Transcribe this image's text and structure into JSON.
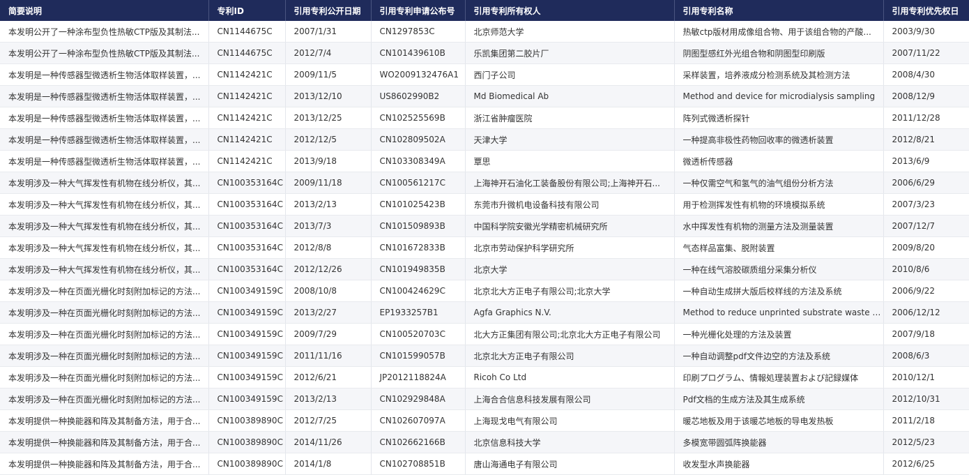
{
  "columns": [
    "简要说明",
    "专利ID",
    "引用专利公开日期",
    "引用专利申请公布号",
    "引用专利所有权人",
    "引用专利名称",
    "引用专利优先权日"
  ],
  "rows": [
    [
      "本发明公开了一种涂布型负性热敏CTP版及其制法...",
      "CN1144675C",
      "2007/1/31",
      "CN1297853C",
      "北京师范大学",
      "热敏ctp版材用成像组合物、用于该组合物的产酸...",
      "2003/9/30"
    ],
    [
      "本发明公开了一种涂布型负性热敏CTP版及其制法...",
      "CN1144675C",
      "2012/7/4",
      "CN101439610B",
      "乐凯集团第二胶片厂",
      "阴图型感红外光组合物和阴图型印刷版",
      "2007/11/22"
    ],
    [
      "本发明是一种传感器型微透析生物活体取样装置，...",
      "CN1142421C",
      "2009/11/5",
      "WO2009132476A1",
      "西门子公司",
      "采样装置，培养液成分检测系统及其检测方法",
      "2008/4/30"
    ],
    [
      "本发明是一种传感器型微透析生物活体取样装置，...",
      "CN1142421C",
      "2013/12/10",
      "US8602990B2",
      "Md Biomedical Ab",
      "Method and device for microdialysis sampling",
      "2008/12/9"
    ],
    [
      "本发明是一种传感器型微透析生物活体取样装置，...",
      "CN1142421C",
      "2013/12/25",
      "CN102525569B",
      "浙江省肿瘤医院",
      "阵列式微透析探针",
      "2011/12/28"
    ],
    [
      "本发明是一种传感器型微透析生物活体取样装置，...",
      "CN1142421C",
      "2012/12/5",
      "CN102809502A",
      "天津大学",
      "一种提高非极性药物回收率的微透析装置",
      "2012/8/21"
    ],
    [
      "本发明是一种传感器型微透析生物活体取样装置，...",
      "CN1142421C",
      "2013/9/18",
      "CN103308349A",
      "覃思",
      "微透析传感器",
      "2013/6/9"
    ],
    [
      "本发明涉及一种大气挥发性有机物在线分析仪，其...",
      "CN100353164C",
      "2009/11/18",
      "CN100561217C",
      "上海神开石油化工装备股份有限公司;上海神开石...",
      "一种仅需空气和氢气的油气组份分析方法",
      "2006/6/29"
    ],
    [
      "本发明涉及一种大气挥发性有机物在线分析仪，其...",
      "CN100353164C",
      "2013/2/13",
      "CN101025423B",
      "东莞市升微机电设备科技有限公司",
      "用于检测挥发性有机物的环境模拟系统",
      "2007/3/23"
    ],
    [
      "本发明涉及一种大气挥发性有机物在线分析仪，其...",
      "CN100353164C",
      "2013/7/3",
      "CN101509893B",
      "中国科学院安徽光学精密机械研究所",
      "水中挥发性有机物的测量方法及测量装置",
      "2007/12/7"
    ],
    [
      "本发明涉及一种大气挥发性有机物在线分析仪，其...",
      "CN100353164C",
      "2012/8/8",
      "CN101672833B",
      "北京市劳动保护科学研究所",
      "气态样品富集、脱附装置",
      "2009/8/20"
    ],
    [
      "本发明涉及一种大气挥发性有机物在线分析仪，其...",
      "CN100353164C",
      "2012/12/26",
      "CN101949835B",
      "北京大学",
      "一种在线气溶胶碳质组分采集分析仪",
      "2010/8/6"
    ],
    [
      "本发明涉及一种在页面光栅化时刻附加标记的方法...",
      "CN100349159C",
      "2008/10/8",
      "CN100424629C",
      "北京北大方正电子有限公司;北京大学",
      "一种自动生成拼大版后校样线的方法及系统",
      "2006/9/22"
    ],
    [
      "本发明涉及一种在页面光栅化时刻附加标记的方法...",
      "CN100349159C",
      "2013/2/27",
      "EP1933257B1",
      "Agfa Graphics N.V.",
      "Method to reduce unprinted substrate waste duri...",
      "2006/12/12"
    ],
    [
      "本发明涉及一种在页面光栅化时刻附加标记的方法...",
      "CN100349159C",
      "2009/7/29",
      "CN100520703C",
      "北大方正集团有限公司;北京北大方正电子有限公司",
      "一种光栅化处理的方法及装置",
      "2007/9/18"
    ],
    [
      "本发明涉及一种在页面光栅化时刻附加标记的方法...",
      "CN100349159C",
      "2011/11/16",
      "CN101599057B",
      "北京北大方正电子有限公司",
      "一种自动调整pdf文件边空的方法及系统",
      "2008/6/3"
    ],
    [
      "本发明涉及一种在页面光栅化时刻附加标记的方法...",
      "CN100349159C",
      "2012/6/21",
      "JP2012118824A",
      "Ricoh Co Ltd",
      "印刷プログラム、情報処理装置および記録媒体",
      "2010/12/1"
    ],
    [
      "本发明涉及一种在页面光栅化时刻附加标记的方法...",
      "CN100349159C",
      "2013/2/13",
      "CN102929848A",
      "上海合合信息科技发展有限公司",
      "Pdf文档的生成方法及其生成系统",
      "2012/10/31"
    ],
    [
      "本发明提供一种换能器和阵及其制备方法，用于合...",
      "CN100389890C",
      "2012/7/25",
      "CN102607097A",
      "上海现戈电气有限公司",
      "暖芯地板及用于该暖芯地板的导电发热板",
      "2011/2/18"
    ],
    [
      "本发明提供一种换能器和阵及其制备方法，用于合...",
      "CN100389890C",
      "2014/11/26",
      "CN102662166B",
      "北京信息科技大学",
      "多模宽带圆弧阵换能器",
      "2012/5/23"
    ],
    [
      "本发明提供一种换能器和阵及其制备方法，用于合...",
      "CN100389890C",
      "2014/1/8",
      "CN102708851B",
      "唐山海通电子有限公司",
      "收发型水声换能器",
      "2012/6/25"
    ]
  ]
}
